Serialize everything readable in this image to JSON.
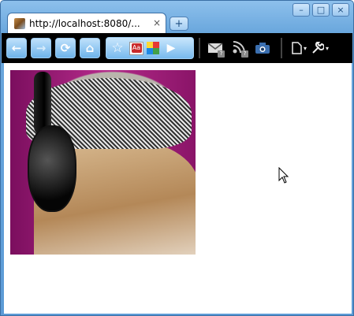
{
  "tab": {
    "title": "http://localhost:8080/...",
    "close_glyph": "×"
  },
  "window_controls": {
    "minimize": "–",
    "maximize": "□",
    "close": "×"
  },
  "new_tab": "+",
  "toolbar": {
    "back": "←",
    "forward": "→",
    "reload": "⟳",
    "home": "⌂",
    "star": "☆",
    "extension_a": "Aa",
    "play": "▶",
    "mail_badge": "?",
    "rss_badge": "?",
    "page_menu_caret": "▾",
    "wrench_menu_caret": "▾"
  },
  "icons": {
    "back": "back-arrow-icon",
    "forward": "forward-arrow-icon",
    "reload": "reload-icon",
    "home": "home-icon",
    "star": "bookmark-star-icon",
    "mail": "gmail-checker-icon",
    "rss": "rss-feed-icon",
    "camera": "screenshot-camera-icon",
    "page": "page-menu-icon",
    "wrench": "wrench-menu-icon",
    "cursor": "mouse-pointer-icon"
  },
  "colors": {
    "title_bar": "#7fb6e8",
    "toolbar": "#000000",
    "button_accent": "#6eb3ea"
  }
}
